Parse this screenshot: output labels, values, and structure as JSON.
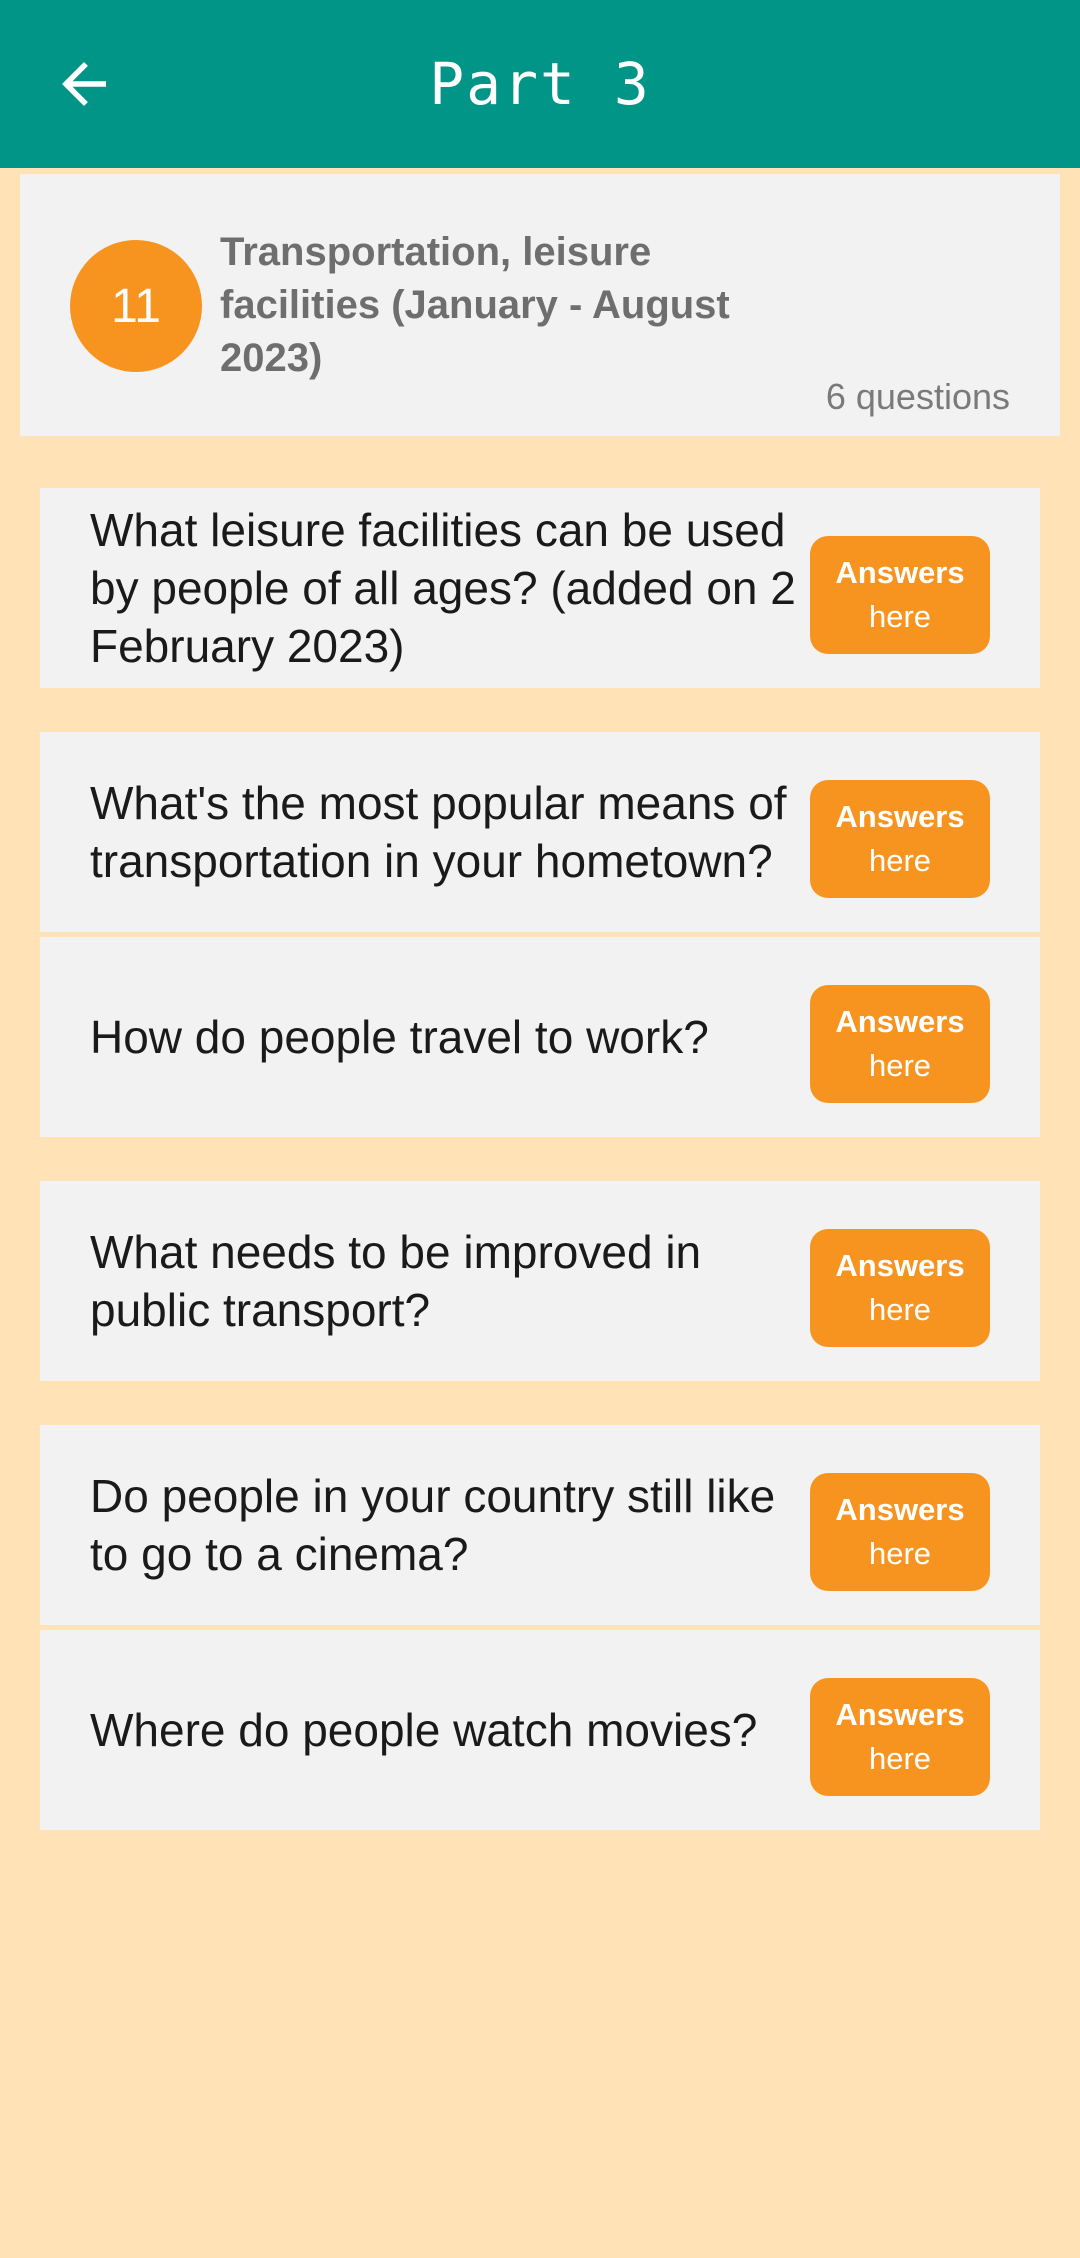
{
  "header": {
    "title": "Part 3",
    "back_icon": "arrow-left-icon",
    "background": "#009587"
  },
  "topic": {
    "number": "11",
    "title": "Transportation, leisure facilities (January - August 2023)",
    "count": "6 questions",
    "badge_color": "#F7941F"
  },
  "questions": [
    {
      "text": "What leisure facilities can be used by people of all ages? (added on 2 February 2023)",
      "btn_line1": "Answers",
      "btn_line2": "here"
    },
    {
      "text": "What's the most popular means of transportation in your hometown?",
      "btn_line1": "Answers",
      "btn_line2": "here"
    },
    {
      "text": "How do people travel to work?",
      "btn_line1": "Answers",
      "btn_line2": "here"
    },
    {
      "text": "What needs to be improved in public transport?",
      "btn_line1": "Answers",
      "btn_line2": "here"
    },
    {
      "text": "Do people in your country still like to go to a cinema?",
      "btn_line1": "Answers",
      "btn_line2": "here"
    },
    {
      "text": "Where do people watch movies?",
      "btn_line1": "Answers",
      "btn_line2": "here"
    }
  ],
  "colors": {
    "page_background": "#FFE2B6",
    "card_background": "#F2F2F2",
    "accent": "#F7941F"
  }
}
